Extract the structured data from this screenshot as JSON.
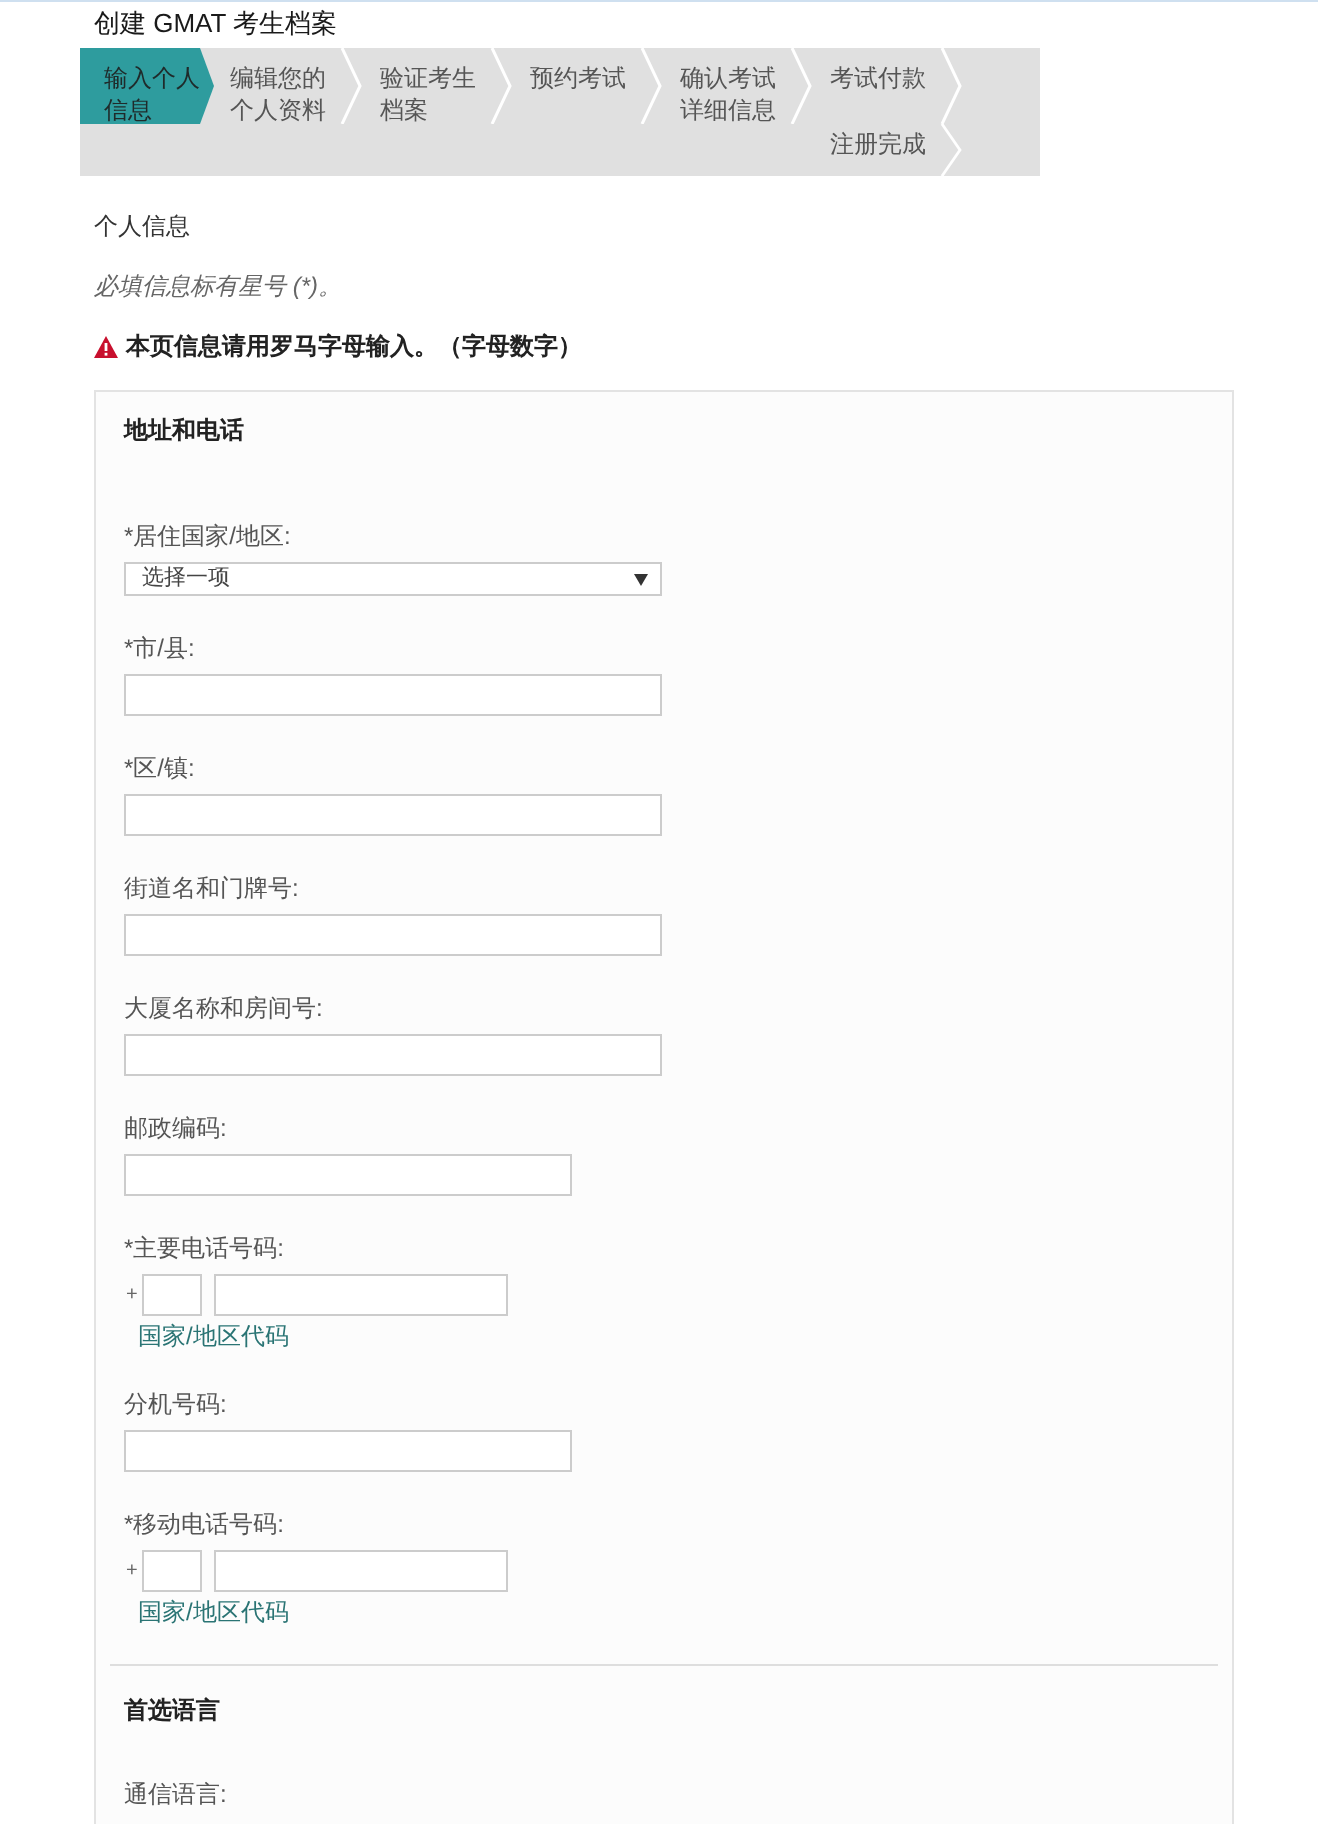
{
  "page_title": "创建 GMAT 考生档案",
  "steps": [
    {
      "label": "输入个人信息",
      "selected": true
    },
    {
      "label": "编辑您的个人资料",
      "selected": false
    },
    {
      "label": "验证考生档案",
      "selected": false
    },
    {
      "label": "预约考试",
      "selected": false
    },
    {
      "label": "确认考试详细信息",
      "selected": false
    },
    {
      "label": "考试付款",
      "selected": false
    },
    {
      "label": "注册完成",
      "selected": false
    }
  ],
  "section_heading": "个人信息",
  "required_note": "必填信息标有星号 (*)。",
  "warning": "本页信息请用罗马字母输入。（字母数字）",
  "sections": [
    {
      "title": "地址和电话",
      "fields": [
        {
          "kind": "select",
          "label": "*居住国家/地区:",
          "value": "选择一项"
        },
        {
          "kind": "text",
          "label": "*市/县:"
        },
        {
          "kind": "text",
          "label": "*区/镇:"
        },
        {
          "kind": "text",
          "label": "街道名和门牌号:"
        },
        {
          "kind": "text",
          "label": "大厦名称和房间号:"
        },
        {
          "kind": "short",
          "label": "邮政编码:"
        },
        {
          "kind": "phone",
          "label": "*主要电话号码:",
          "prefix": "+",
          "hint": "国家/地区代码"
        },
        {
          "kind": "short",
          "label": "分机号码:"
        },
        {
          "kind": "phone",
          "label": "*移动电话号码:",
          "prefix": "+",
          "hint": "国家/地区代码"
        }
      ]
    },
    {
      "title": "首选语言",
      "fields": [
        {
          "kind": "label",
          "label": "通信语言:"
        }
      ]
    }
  ]
}
